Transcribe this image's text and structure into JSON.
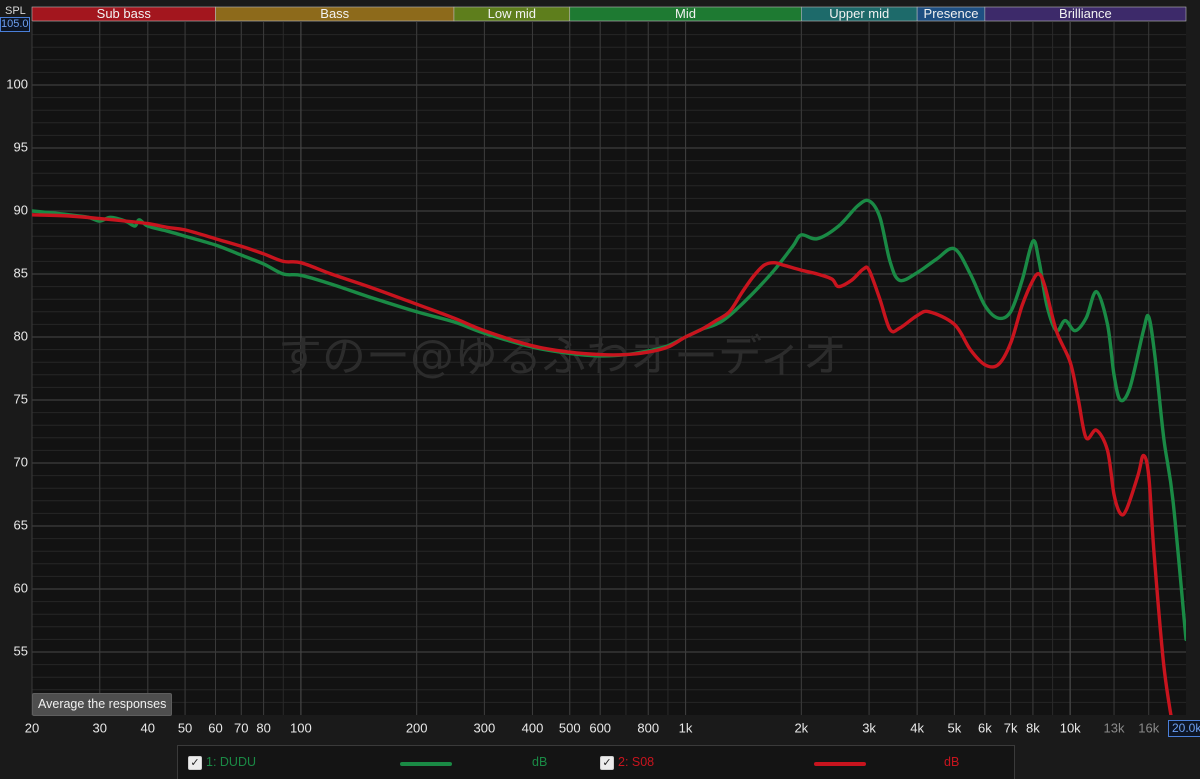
{
  "bands": [
    {
      "label": "Sub bass",
      "from": 20,
      "to": 60,
      "color": "#a3161e"
    },
    {
      "label": "Bass",
      "from": 60,
      "to": 250,
      "color": "#8d6a1b"
    },
    {
      "label": "Low mid",
      "from": 250,
      "to": 500,
      "color": "#5e7e1c"
    },
    {
      "label": "Mid",
      "from": 500,
      "to": 2000,
      "color": "#1e7a32"
    },
    {
      "label": "Upper mid",
      "from": 2000,
      "to": 4000,
      "color": "#1d6a6a"
    },
    {
      "label": "Presence",
      "from": 4000,
      "to": 6000,
      "color": "#1e4f82"
    },
    {
      "label": "Brilliance",
      "from": 6000,
      "to": 20000,
      "color": "#3d2a6a"
    }
  ],
  "axis": {
    "y_label": "SPL",
    "y_max_field": "105.00",
    "x_max_field": "20.0k",
    "watermark": "すのー@ゆるふわオーディオ"
  },
  "button_label": "Average the responses",
  "chart_data": {
    "type": "line",
    "xscale": "log",
    "xlim": [
      20,
      20000
    ],
    "ylim": [
      50,
      105
    ],
    "yticks": [
      55,
      60,
      65,
      70,
      75,
      80,
      85,
      90,
      95,
      100
    ],
    "xticks": [
      {
        "value": 20,
        "label": "20"
      },
      {
        "value": 30,
        "label": "30"
      },
      {
        "value": 40,
        "label": "40"
      },
      {
        "value": 50,
        "label": "50"
      },
      {
        "value": 60,
        "label": "60"
      },
      {
        "value": 70,
        "label": "70"
      },
      {
        "value": 80,
        "label": "80"
      },
      {
        "value": 100,
        "label": "100"
      },
      {
        "value": 200,
        "label": "200"
      },
      {
        "value": 300,
        "label": "300"
      },
      {
        "value": 400,
        "label": "400"
      },
      {
        "value": 500,
        "label": "500"
      },
      {
        "value": 600,
        "label": "600"
      },
      {
        "value": 800,
        "label": "800"
      },
      {
        "value": 1000,
        "label": "1k"
      },
      {
        "value": 2000,
        "label": "2k"
      },
      {
        "value": 3000,
        "label": "3k"
      },
      {
        "value": 4000,
        "label": "4k"
      },
      {
        "value": 5000,
        "label": "5k"
      },
      {
        "value": 6000,
        "label": "6k"
      },
      {
        "value": 7000,
        "label": "7k"
      },
      {
        "value": 8000,
        "label": "8k"
      },
      {
        "value": 10000,
        "label": "10k"
      },
      {
        "value": 13000,
        "label": "13k",
        "dim": true
      },
      {
        "value": 16000,
        "label": "16k",
        "dim": true
      }
    ],
    "grid": true,
    "series": [
      {
        "name": "1: DUDU",
        "unit": "dB",
        "color": "#1a8a45",
        "points": [
          [
            20,
            90
          ],
          [
            25,
            89.7
          ],
          [
            28,
            89.5
          ],
          [
            30,
            89.2
          ],
          [
            32,
            89.5
          ],
          [
            35,
            89.2
          ],
          [
            37,
            88.8
          ],
          [
            38,
            89.3
          ],
          [
            40,
            88.8
          ],
          [
            45,
            88.4
          ],
          [
            50,
            88
          ],
          [
            60,
            87.3
          ],
          [
            70,
            86.5
          ],
          [
            80,
            85.8
          ],
          [
            90,
            85
          ],
          [
            100,
            84.9
          ],
          [
            120,
            84.2
          ],
          [
            150,
            83.2
          ],
          [
            200,
            82
          ],
          [
            250,
            81.2
          ],
          [
            300,
            80.3
          ],
          [
            400,
            79.2
          ],
          [
            500,
            78.7
          ],
          [
            600,
            78.5
          ],
          [
            700,
            78.6
          ],
          [
            800,
            78.9
          ],
          [
            900,
            79.3
          ],
          [
            1000,
            80
          ],
          [
            1100,
            80.6
          ],
          [
            1200,
            81
          ],
          [
            1300,
            81.7
          ],
          [
            1500,
            83.5
          ],
          [
            1700,
            85.3
          ],
          [
            1900,
            87.2
          ],
          [
            2000,
            88.1
          ],
          [
            2200,
            87.8
          ],
          [
            2500,
            88.8
          ],
          [
            2800,
            90.4
          ],
          [
            3000,
            90.8
          ],
          [
            3200,
            89.5
          ],
          [
            3400,
            86
          ],
          [
            3600,
            84.5
          ],
          [
            4000,
            85.1
          ],
          [
            4500,
            86.2
          ],
          [
            5000,
            87
          ],
          [
            5500,
            85
          ],
          [
            6000,
            82.5
          ],
          [
            6500,
            81.5
          ],
          [
            7000,
            82
          ],
          [
            7500,
            84.5
          ],
          [
            8000,
            87.6
          ],
          [
            8300,
            86
          ],
          [
            8700,
            82.5
          ],
          [
            9200,
            80.5
          ],
          [
            9700,
            81.3
          ],
          [
            10300,
            80.5
          ],
          [
            11000,
            81.5
          ],
          [
            11700,
            83.6
          ],
          [
            12500,
            81
          ],
          [
            13000,
            77
          ],
          [
            13500,
            75
          ],
          [
            14300,
            76
          ],
          [
            15500,
            80.5
          ],
          [
            16000,
            81.6
          ],
          [
            16600,
            78.5
          ],
          [
            17500,
            72
          ],
          [
            18500,
            67
          ],
          [
            20000,
            56
          ]
        ]
      },
      {
        "name": "2: S08",
        "unit": "dB",
        "color": "#c8141e",
        "points": [
          [
            20,
            89.7
          ],
          [
            25,
            89.6
          ],
          [
            30,
            89.4
          ],
          [
            35,
            89.2
          ],
          [
            40,
            89
          ],
          [
            45,
            88.7
          ],
          [
            50,
            88.5
          ],
          [
            60,
            87.8
          ],
          [
            70,
            87.2
          ],
          [
            80,
            86.6
          ],
          [
            90,
            86
          ],
          [
            100,
            85.9
          ],
          [
            120,
            85
          ],
          [
            150,
            84
          ],
          [
            200,
            82.6
          ],
          [
            250,
            81.5
          ],
          [
            300,
            80.5
          ],
          [
            400,
            79.3
          ],
          [
            500,
            78.8
          ],
          [
            600,
            78.6
          ],
          [
            700,
            78.6
          ],
          [
            800,
            78.8
          ],
          [
            900,
            79.2
          ],
          [
            1000,
            80
          ],
          [
            1100,
            80.6
          ],
          [
            1200,
            81.3
          ],
          [
            1300,
            82
          ],
          [
            1400,
            83.5
          ],
          [
            1500,
            84.8
          ],
          [
            1600,
            85.7
          ],
          [
            1700,
            85.9
          ],
          [
            1800,
            85.7
          ],
          [
            2000,
            85.3
          ],
          [
            2200,
            85
          ],
          [
            2400,
            84.6
          ],
          [
            2500,
            84
          ],
          [
            2700,
            84.5
          ],
          [
            2900,
            85.4
          ],
          [
            3000,
            85.3
          ],
          [
            3200,
            83
          ],
          [
            3400,
            80.6
          ],
          [
            3600,
            80.7
          ],
          [
            4000,
            81.7
          ],
          [
            4300,
            82
          ],
          [
            5000,
            81
          ],
          [
            5500,
            79
          ],
          [
            6000,
            77.8
          ],
          [
            6500,
            77.8
          ],
          [
            7000,
            79.5
          ],
          [
            7500,
            82.5
          ],
          [
            8000,
            84.5
          ],
          [
            8300,
            85
          ],
          [
            8600,
            84
          ],
          [
            9200,
            80.5
          ],
          [
            10000,
            78
          ],
          [
            10500,
            75
          ],
          [
            11000,
            72
          ],
          [
            11700,
            72.6
          ],
          [
            12500,
            71
          ],
          [
            13000,
            67.5
          ],
          [
            13500,
            66
          ],
          [
            14000,
            66.3
          ],
          [
            15000,
            69
          ],
          [
            15500,
            70.6
          ],
          [
            16000,
            69
          ],
          [
            16500,
            63
          ],
          [
            17500,
            54
          ],
          [
            18500,
            49
          ]
        ]
      }
    ]
  },
  "legend": [
    {
      "name": "1: DUDU",
      "unit": "dB",
      "color": "#1a8a45",
      "checked": true
    },
    {
      "name": "2: S08",
      "unit": "dB",
      "color": "#c8141e",
      "checked": true
    }
  ]
}
